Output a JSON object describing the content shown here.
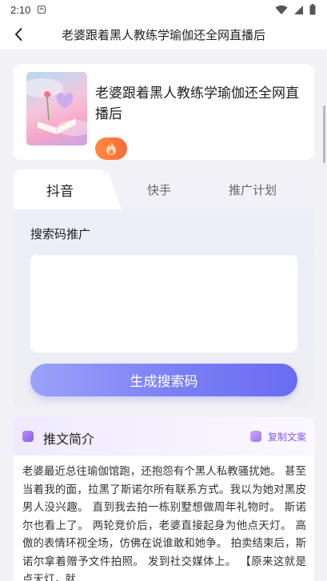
{
  "status_bar": {
    "time": "2:10"
  },
  "nav": {
    "title": "老婆跟着黑人教练学瑜伽还全网直播后"
  },
  "drama": {
    "title": "老婆跟着黑人教练学瑜伽还全网直播后",
    "tag_icon": "flame-icon"
  },
  "promo": {
    "tabs": [
      {
        "label": "抖音",
        "active": true
      },
      {
        "label": "快手",
        "active": false
      },
      {
        "label": "推广计划",
        "active": false
      }
    ],
    "section_label": "搜索码推广",
    "code_placeholder": "",
    "generate_label": "生成搜索码"
  },
  "intro": {
    "title": "推文简介",
    "copy_label": "复制文案",
    "text": "老婆最近总往瑜伽馆跑，还抱怨有个黑人私教骚扰她。 甚至当着我的面，拉黑了斯诺尔所有联系方式。我以为她对黑皮男人没兴趣。 直到我去拍一栋别墅想做周年礼物时。 斯诺尔也看上了。 两轮竞价后，老婆直接起身为他点天灯。 高傲的表情环视全场，仿佛在说谁敢和她争。 拍卖结束后，斯诺尔拿着赠予文件拍照。 发到社交媒体上。 【原来这就是点天灯，就"
  },
  "colors": {
    "accent": "#7b7ff5",
    "intro_accent": "#8a5cf0",
    "tag": "#ff7a3d"
  }
}
